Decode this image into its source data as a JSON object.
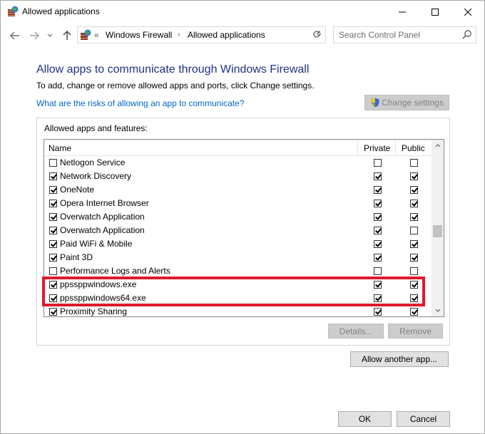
{
  "window": {
    "title": "Allowed applications"
  },
  "address": {
    "overflow": "«",
    "crumbs": [
      "Windows Firewall",
      "Allowed applications"
    ]
  },
  "search": {
    "placeholder": "Search Control Panel"
  },
  "content": {
    "heading": "Allow apps to communicate through Windows Firewall",
    "subtext": "To add, change or remove allowed apps and ports, click Change settings.",
    "risk_link": "What are the risks of allowing an app to communicate?",
    "change_settings": "Change settings",
    "group_label": "Allowed apps and features:",
    "columns": {
      "name": "Name",
      "private": "Private",
      "public": "Public"
    },
    "rows": [
      {
        "name": "Netlogon Service",
        "enabled": false,
        "private": false,
        "public": false
      },
      {
        "name": "Network Discovery",
        "enabled": true,
        "private": true,
        "public": true
      },
      {
        "name": "OneNote",
        "enabled": true,
        "private": true,
        "public": true
      },
      {
        "name": "Opera Internet Browser",
        "enabled": true,
        "private": true,
        "public": true
      },
      {
        "name": "Overwatch Application",
        "enabled": true,
        "private": true,
        "public": true
      },
      {
        "name": "Overwatch Application",
        "enabled": true,
        "private": true,
        "public": false
      },
      {
        "name": "Paid WiFi & Mobile",
        "enabled": true,
        "private": true,
        "public": true
      },
      {
        "name": "Paint 3D",
        "enabled": true,
        "private": true,
        "public": true
      },
      {
        "name": "Performance Logs and Alerts",
        "enabled": false,
        "private": false,
        "public": false
      },
      {
        "name": "ppssppwindows.exe",
        "enabled": true,
        "private": true,
        "public": true
      },
      {
        "name": "ppssppwindows64.exe",
        "enabled": true,
        "private": true,
        "public": true
      },
      {
        "name": "Proximity Sharing",
        "enabled": true,
        "private": true,
        "public": true
      }
    ],
    "details": "Details...",
    "remove": "Remove",
    "allow_another": "Allow another app..."
  },
  "footer": {
    "ok": "OK",
    "cancel": "Cancel"
  },
  "colors": {
    "heading": "#1e3287",
    "link": "#0066cc",
    "highlight": "#e0192c"
  },
  "icons": [
    "firewall-icon",
    "minimize-icon",
    "maximize-icon",
    "close-icon",
    "back-arrow-icon",
    "forward-arrow-icon",
    "recent-dropdown-icon",
    "up-arrow-icon",
    "chevron-down-icon",
    "refresh-icon",
    "search-icon",
    "shield-icon",
    "scroll-up-icon",
    "scroll-down-icon"
  ]
}
